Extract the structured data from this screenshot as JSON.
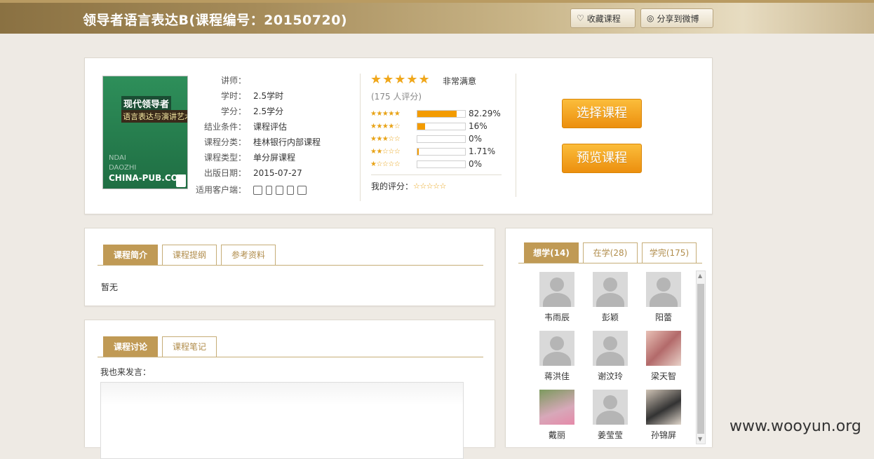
{
  "header": {
    "title": "领导者语言表达B(课程编号：20150720)",
    "favorite_label": "收藏课程",
    "share_label": "分享到微博"
  },
  "course": {
    "cover": {
      "title": "现代领导者",
      "subtitle": "语言表达与演讲艺术",
      "publisher": "CHINA-PUB.COM"
    },
    "info": [
      {
        "key": "讲师：",
        "value": ""
      },
      {
        "key": "学时：",
        "value": "2.5学时"
      },
      {
        "key": "学分：",
        "value": "2.5学分"
      },
      {
        "key": "结业条件：",
        "value": "课程评估"
      },
      {
        "key": "课程分类：",
        "value": "桂林银行内部课程"
      },
      {
        "key": "课程类型：",
        "value": "单分屏课程"
      },
      {
        "key": "出版日期：",
        "value": "2015-07-27"
      },
      {
        "key": "适用客户端：",
        "value": ""
      }
    ],
    "clients": [
      "desktop-icon",
      "phone-icon",
      "apple-icon",
      "android-icon",
      "tablet-icon"
    ]
  },
  "rating": {
    "stars": 5,
    "label": "非常满意",
    "count": "(175 人评分)",
    "breakdown": [
      {
        "stars": 5,
        "percent": "82.29%",
        "fraction": 0.8229
      },
      {
        "stars": 4,
        "percent": "16%",
        "fraction": 0.16
      },
      {
        "stars": 3,
        "percent": "0%",
        "fraction": 0
      },
      {
        "stars": 2,
        "percent": "1.71%",
        "fraction": 0.0171
      },
      {
        "stars": 1,
        "percent": "0%",
        "fraction": 0
      }
    ],
    "my_rating_label": "我的评分："
  },
  "actions": {
    "select_label": "选择课程",
    "preview_label": "预览课程"
  },
  "intro_tabs": [
    "课程简介",
    "课程提纲",
    "参考资料"
  ],
  "intro_content": "暂无",
  "discussion_tabs": [
    "课程讨论",
    "课程笔记"
  ],
  "discussion_prompt": "我也来发言：",
  "learner_tabs": [
    "想学(14)",
    "在学(28)",
    "学完(175)"
  ],
  "learners": [
    {
      "name": "韦雨辰",
      "avatar": "default"
    },
    {
      "name": "彭颖",
      "avatar": "default"
    },
    {
      "name": "阳蕾",
      "avatar": "default"
    },
    {
      "name": "蒋洪佳",
      "avatar": "default"
    },
    {
      "name": "谢汶玲",
      "avatar": "default"
    },
    {
      "name": "梁天智",
      "avatar": "photo1"
    },
    {
      "name": "戴丽",
      "avatar": "photo2"
    },
    {
      "name": "姜莹莹",
      "avatar": "default"
    },
    {
      "name": "孙锦屏",
      "avatar": "photo3"
    }
  ],
  "watermark": "www.wooyun.org",
  "colors": {
    "accent": "#c09a55",
    "button": "#f39b00",
    "star": "#f0a71b"
  }
}
